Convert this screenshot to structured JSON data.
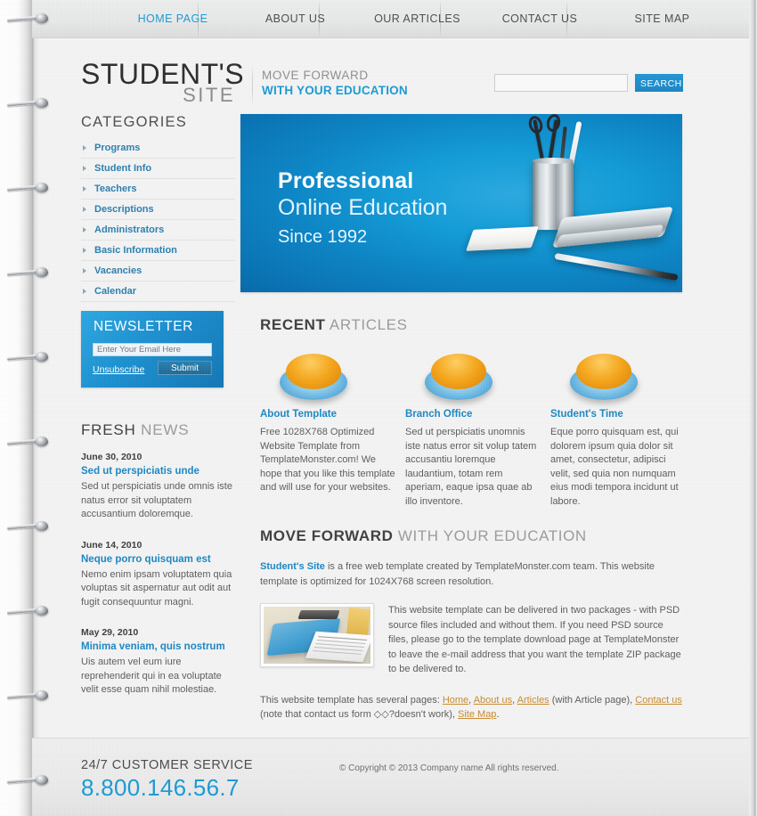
{
  "colors": {
    "accent_blue": "#1a9ad6",
    "link_blue": "#1a87c4",
    "cat_blue": "#2a7fb0",
    "orange_link": "#c98a2e",
    "text_gray": "#5c5c5c",
    "heading_gray": "#4d4d4d",
    "muted_gray": "#9b9b9b",
    "banner_blue": "#119cd8",
    "newsletter_blue": "#1b8fd0"
  },
  "nav": {
    "items": [
      {
        "label": "HOME PAGE",
        "active": true
      },
      {
        "label": "ABOUT US",
        "active": false
      },
      {
        "label": "OUR ARTICLES",
        "active": false
      },
      {
        "label": "CONTACT US",
        "active": false
      },
      {
        "label": "SITE MAP",
        "active": false
      }
    ]
  },
  "header": {
    "logo_line1": "STUDENT'S",
    "logo_line2": "SITE",
    "slogan_line1": "MOVE FORWARD",
    "slogan_line2": "WITH YOUR EDUCATION",
    "search_value": "",
    "search_placeholder": "",
    "search_button": "SEARCH"
  },
  "sidebar": {
    "categories_heading": "CATEGORIES",
    "categories": [
      {
        "label": "Programs"
      },
      {
        "label": "Student Info"
      },
      {
        "label": "Teachers"
      },
      {
        "label": "Descriptions"
      },
      {
        "label": "Administrators"
      },
      {
        "label": "Basic Information"
      },
      {
        "label": "Vacancies"
      },
      {
        "label": "Calendar"
      }
    ],
    "newsletter": {
      "title": "NEWSLETTER",
      "email_value": "",
      "email_placeholder": "Enter Your Email Here",
      "unsubscribe_label": "Unsubscribe",
      "submit_label": "Submit"
    },
    "news": {
      "heading_bold": "FRESH",
      "heading_light": " NEWS",
      "items": [
        {
          "date": "June 30, 2010",
          "title": "Sed ut perspiciatis unde",
          "text": "Sed ut perspiciatis unde omnis iste natus error sit voluptatem accusantium doloremque."
        },
        {
          "date": "June 14, 2010",
          "title": "Neque porro quisquam est",
          "text": "Nemo enim ipsam voluptatem quia voluptas sit aspernatur aut odit aut fugit consequuntur magni."
        },
        {
          "date": "May 29, 2010",
          "title": "Minima veniam, quis nostrum",
          "text": "Uis autem vel eum iure reprehenderit qui in ea voluptate velit esse quam nihil molestiae."
        }
      ]
    }
  },
  "banner": {
    "line1": "Professional",
    "line2": "Online Education",
    "line3": "Since 1992"
  },
  "recent": {
    "heading_bold": "RECENT",
    "heading_light": " ARTICLES",
    "cards": [
      {
        "icon": "blue-disc-icon",
        "title": "About Template",
        "text": "Free 1028X768 Optimized Website Template from TemplateMonster.com! We hope that you like this template and will use for your websites."
      },
      {
        "icon": "globe-disc-icon",
        "title": "Branch Office",
        "text": "Sed ut perspiciatis unomnis iste natus error sit volup tatem accusantiu loremque laudantium, totam rem aperiam, eaque ipsa quae ab illo inventore."
      },
      {
        "icon": "clock-disc-icon",
        "title": "Student's Time",
        "text": "Eque porro quisquam est, qui dolorem ipsum quia dolor sit amet, consectetur, adipisci velit, sed quia non numquam eius modi tempora incidunt ut labore."
      }
    ]
  },
  "move_forward": {
    "heading_bold": "MOVE FORWARD",
    "heading_light": " WITH YOUR EDUCATION",
    "lead_link": "Student's Site",
    "lead_rest": " is a free web template created by TemplateMonster.com team. This website template is optimized for 1024X768 screen resolution.",
    "image_alt": "office-folder-photo",
    "image_text": "This website template can be delivered in two packages - with PSD source files included and without them. If you need PSD source files, please go to the template download page at TemplateMonster to leave the e-mail address that you want the template ZIP package to be delivered to.",
    "pages_prefix": "This website template has several pages: ",
    "pages_links": [
      "Home",
      "About us",
      "Articles",
      "Contact us",
      "Site Map"
    ],
    "pages_sep1": ", ",
    "pages_sep2": ", ",
    "pages_mid": " (with Article page), ",
    "pages_note": " (note that contact us form ◇◇?doesn't work), ",
    "pages_end": "."
  },
  "footer": {
    "customer_service_label": "24/7 CUSTOMER SERVICE",
    "phone": "8.800.146.56.7",
    "copyright": "© Copyright © 2013 Company name All rights reserved."
  }
}
